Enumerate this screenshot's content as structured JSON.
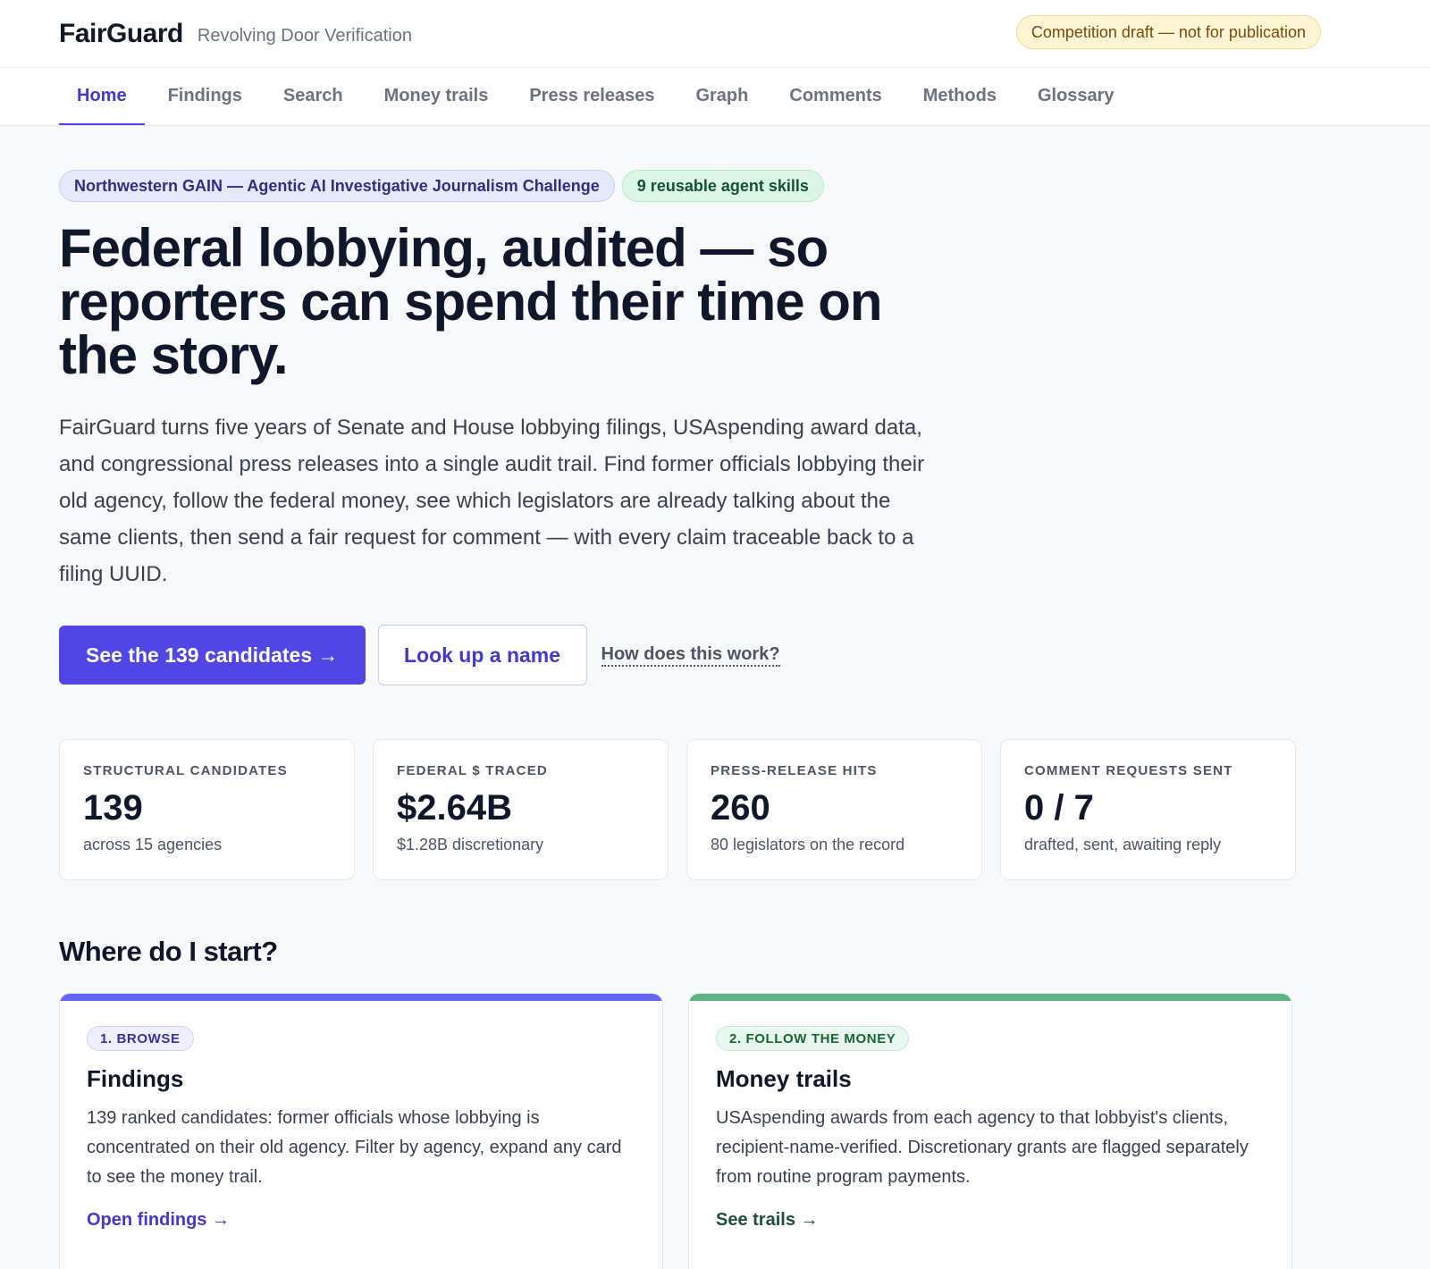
{
  "header": {
    "brand": "FairGuard",
    "tagline": "Revolving Door Verification",
    "draft_notice": "Competition draft — not for publication"
  },
  "nav": {
    "items": [
      "Home",
      "Findings",
      "Search",
      "Money trails",
      "Press releases",
      "Graph",
      "Comments",
      "Methods",
      "Glossary"
    ],
    "active": "Home"
  },
  "hero": {
    "badge_challenge": "Northwestern GAIN — Agentic AI Investigative Journalism Challenge",
    "badge_skills": "9 reusable agent skills",
    "title": "Federal lobbying, audited — so reporters can spend their time on the story.",
    "description": "FairGuard turns five years of Senate and House lobbying filings, USAspending award data, and congressional press releases into a single audit trail. Find former officials lobbying their old agency, follow the federal money, see which legislators are already talking about the same clients, then send a fair request for comment — with every claim traceable back to a filing UUID.",
    "cta_primary": "See the 139 candidates →",
    "cta_secondary": "Look up a name",
    "cta_link": "How does this work?"
  },
  "stats": [
    {
      "label": "STRUCTURAL CANDIDATES",
      "value": "139",
      "sub": "across 15 agencies"
    },
    {
      "label": "FEDERAL $ TRACED",
      "value": "$2.64B",
      "sub": "$1.28B discretionary"
    },
    {
      "label": "PRESS-RELEASE HITS",
      "value": "260",
      "sub": "80 legislators on the record"
    },
    {
      "label": "COMMENT REQUESTS SENT",
      "value": "0 / 7",
      "sub": "drafted, sent, awaiting reply"
    }
  ],
  "start": {
    "title": "Where do I start?",
    "cards": [
      {
        "tag": "1. BROWSE",
        "title": "Findings",
        "desc": "139 ranked candidates: former officials whose lobbying is concentrated on their old agency. Filter by agency, expand any card to see the money trail.",
        "link": "Open findings →"
      },
      {
        "tag": "2. FOLLOW THE MONEY",
        "title": "Money trails",
        "desc": "USAspending awards from each agency to that lobbyist's clients, recipient-name-verified. Discretionary grants are flagged separately from routine program payments.",
        "link": "See trails →"
      }
    ]
  },
  "colors": {
    "accent": "#4f46e5",
    "accent_green": "#5fb387",
    "draft_bg": "#fdf5d3"
  }
}
